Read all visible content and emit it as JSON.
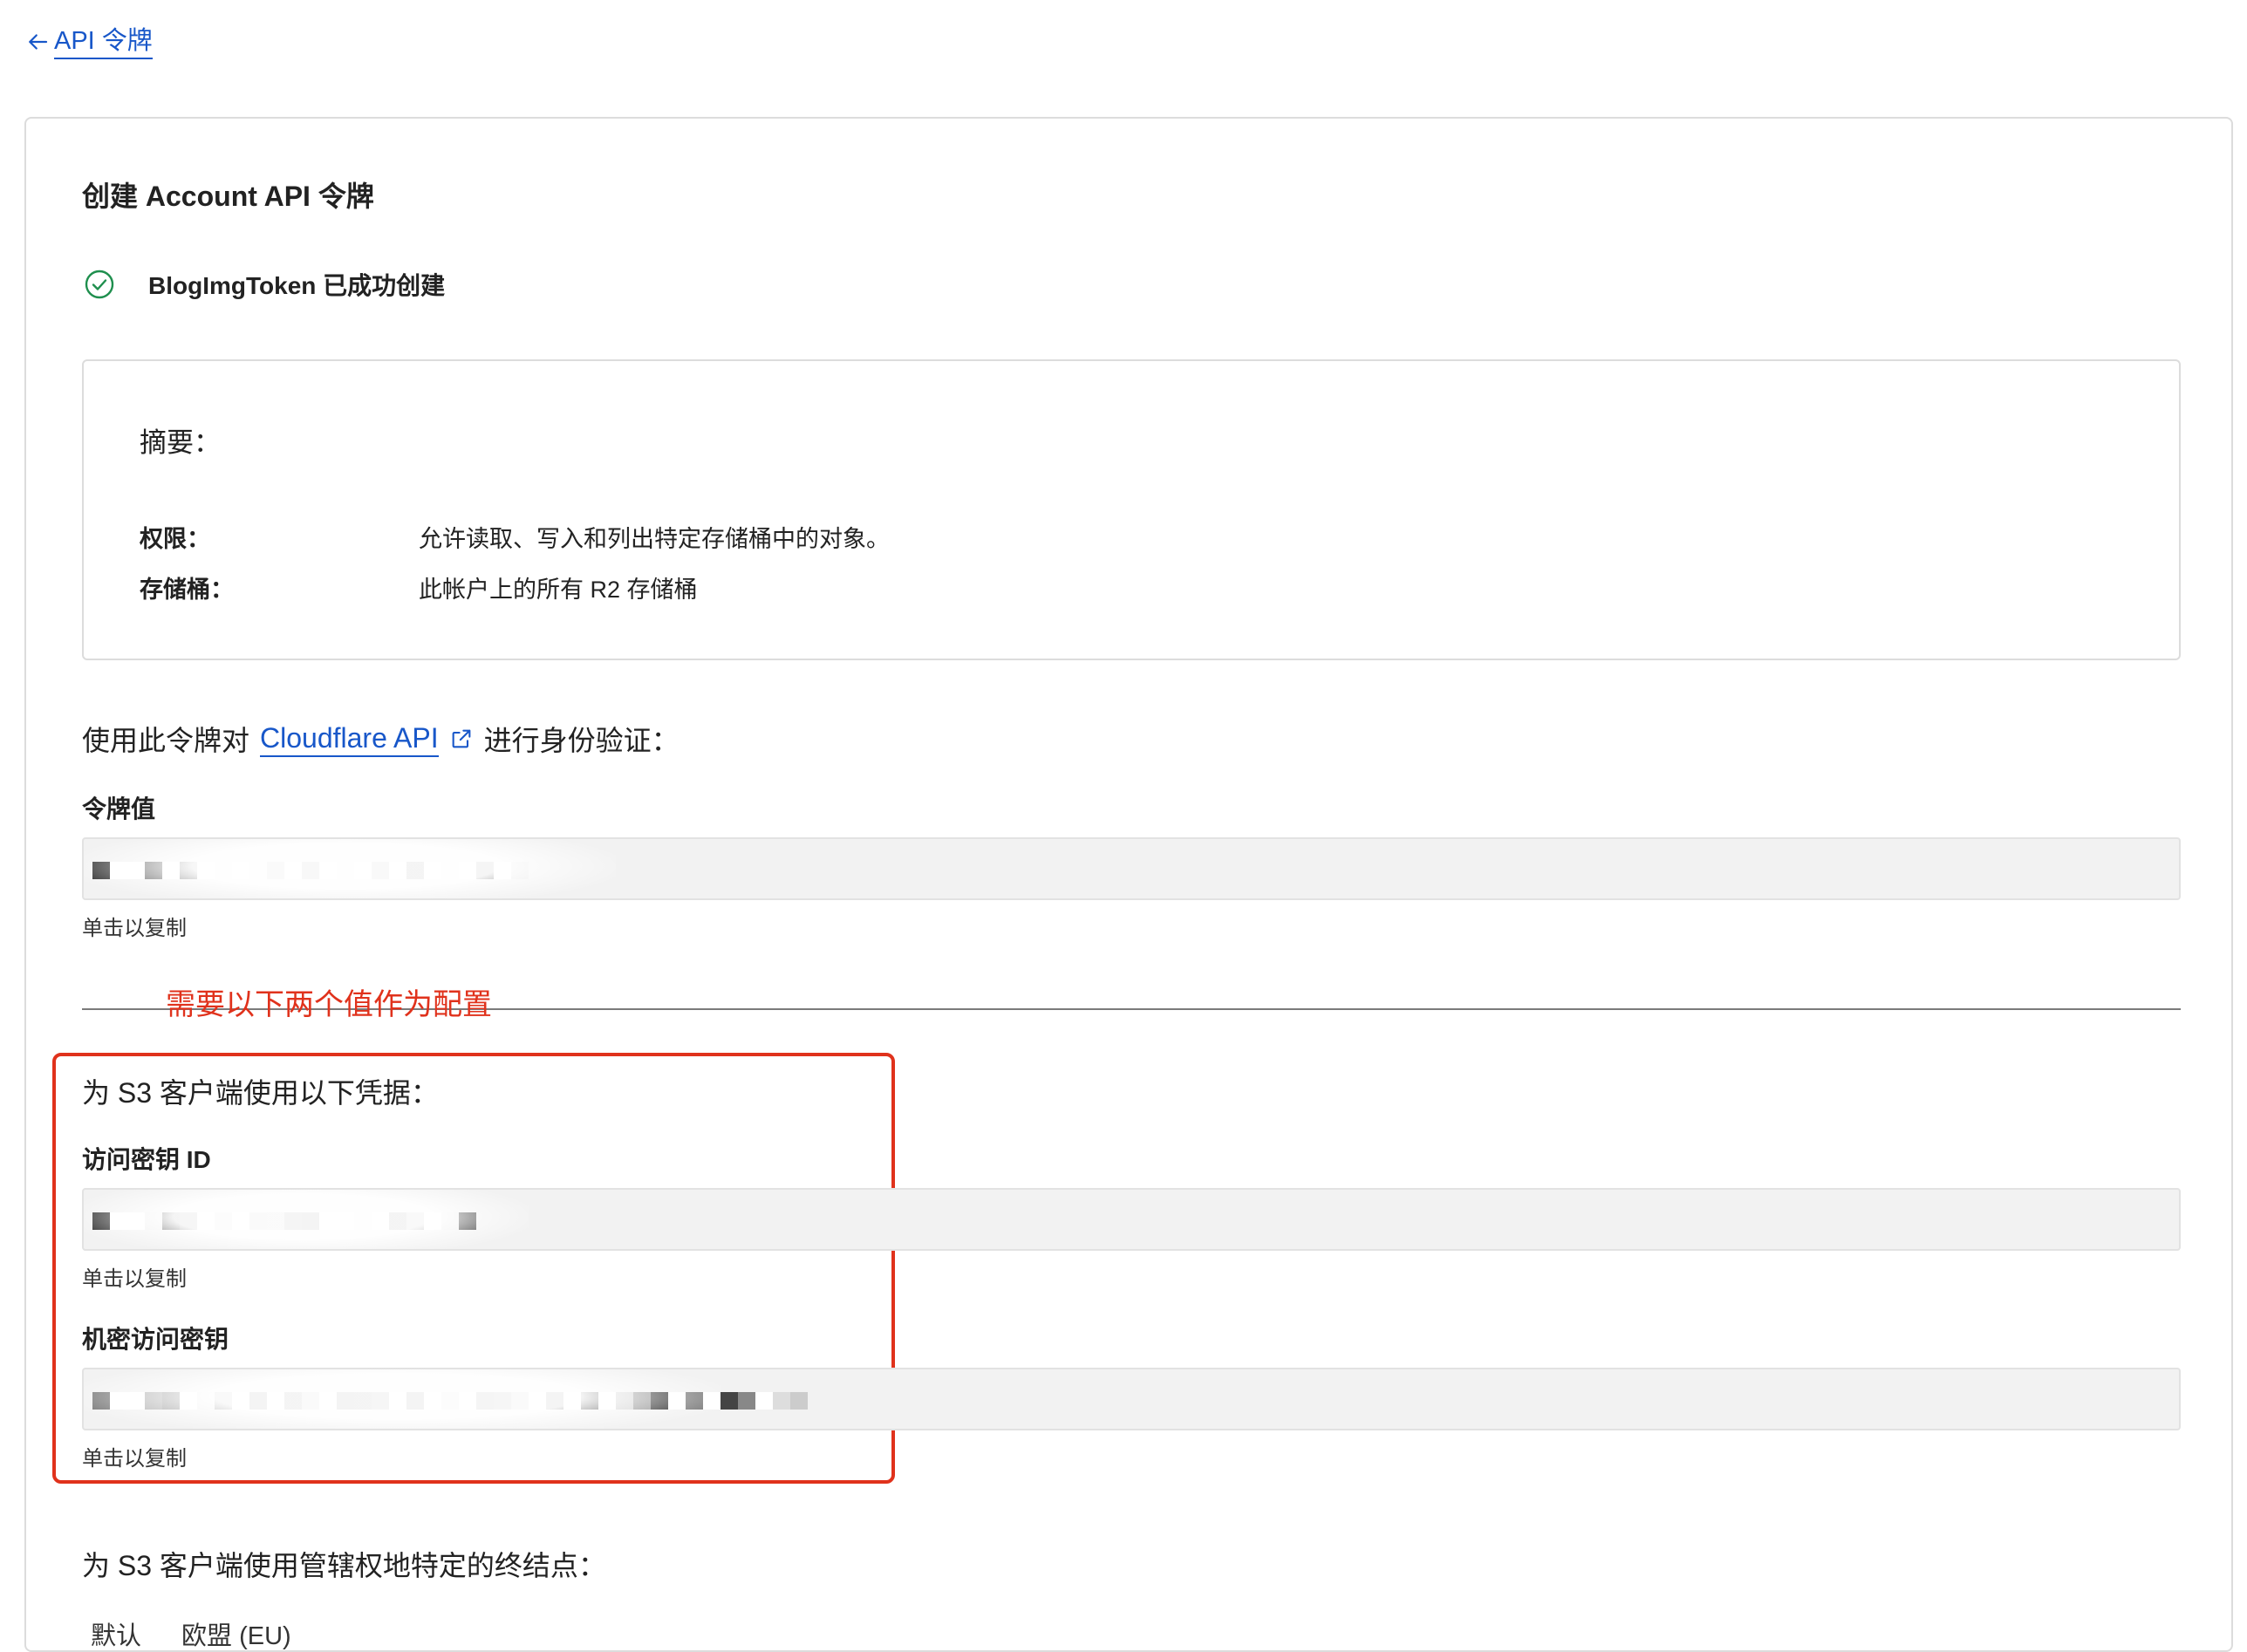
{
  "back_link": {
    "label": "API 令牌"
  },
  "title": "创建 Account API 令牌",
  "success": {
    "text": "BlogImgToken 已成功创建"
  },
  "summary": {
    "title": "摘要：",
    "rows": [
      {
        "key": "权限：",
        "value": "允许读取、写入和列出特定存储桶中的对象。"
      },
      {
        "key": "存储桶：",
        "value": "此帐户上的所有 R2 存储桶"
      }
    ]
  },
  "auth": {
    "prefix": "使用此令牌对",
    "link": "Cloudflare API",
    "suffix": "进行身份验证："
  },
  "token": {
    "label": "令牌值",
    "hint": "单击以复制"
  },
  "annotation": "需要以下两个值作为配置",
  "s3": {
    "heading": "为 S3 客户端使用以下凭据：",
    "access_key": {
      "label": "访问密钥 ID",
      "hint": "单击以复制"
    },
    "secret_key": {
      "label": "机密访问密钥",
      "hint": "单击以复制"
    }
  },
  "endpoints": {
    "heading": "为 S3 客户端使用管辖权地特定的终结点：",
    "tabs": [
      "默认",
      "欧盟 (EU)"
    ]
  },
  "colors": {
    "link": "#1857c9",
    "success": "#1f8f4e",
    "annotation": "#e0321c"
  }
}
